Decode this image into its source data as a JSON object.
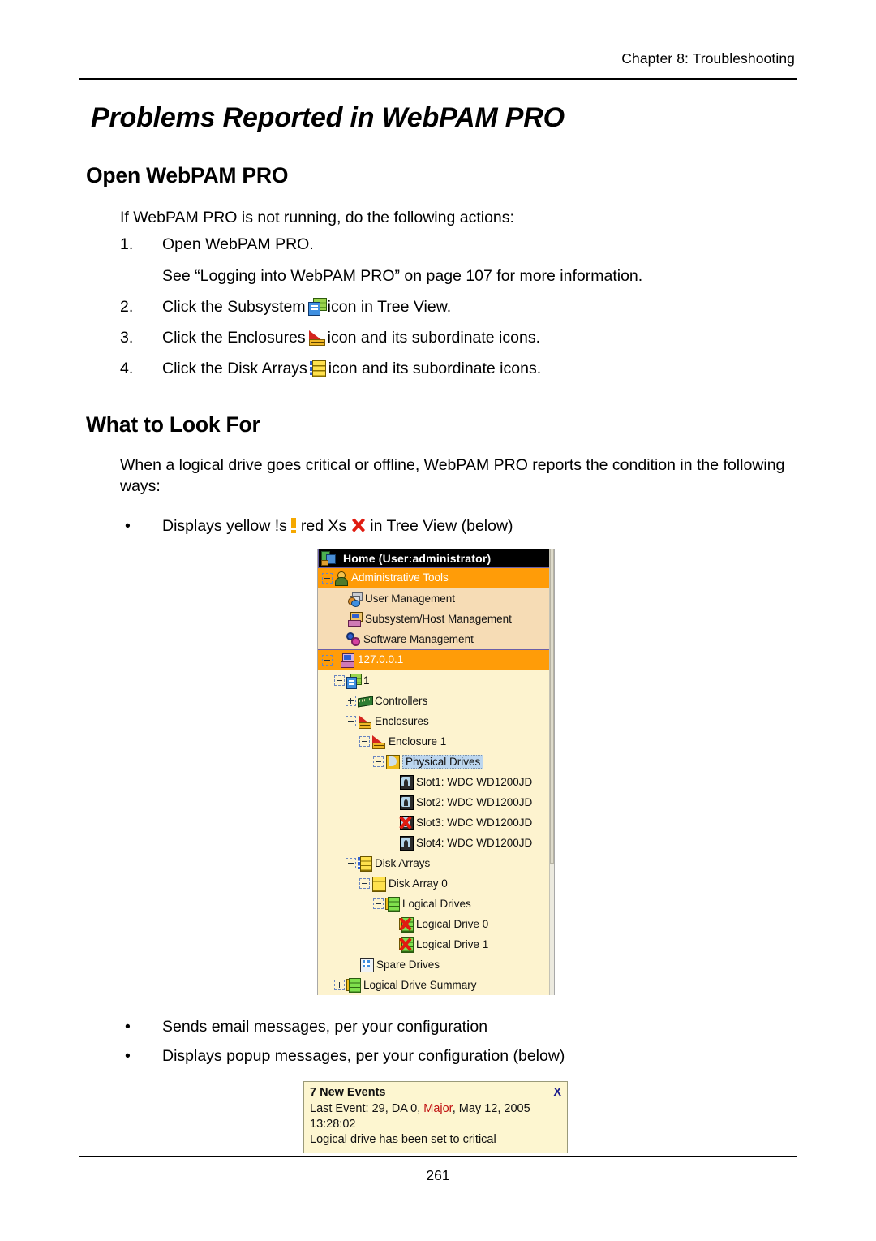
{
  "page": {
    "running_head": "Chapter 8: Troubleshooting",
    "page_number": "261",
    "title": "Problems Reported in WebPAM PRO"
  },
  "sections": {
    "open": {
      "heading": "Open WebPAM PRO",
      "intro": "If WebPAM PRO is not running, do the following actions:",
      "steps": [
        {
          "num": "1.",
          "text": "Open WebPAM PRO.",
          "note": "See “Logging into WebPAM PRO” on page 107 for more information.",
          "icon": ""
        },
        {
          "num": "2.",
          "text_before": "Click the Subsystem",
          "icon": "subsystem-icon",
          "text_after": "icon in Tree View."
        },
        {
          "num": "3.",
          "text_before": "Click the Enclosures",
          "icon": "enclosure-icon",
          "text_after": "icon and its subordinate icons."
        },
        {
          "num": "4.",
          "text_before": "Click the Disk Arrays",
          "icon": "disk-array-icon",
          "text_after": "icon and its subordinate icons."
        }
      ]
    },
    "look": {
      "heading": "What to Look For",
      "intro": "When a logical drive goes critical or offline, WebPAM PRO reports the condition in the following ways:",
      "bullet_dot": "•",
      "bullets_top": [
        {
          "text_before": "Displays yellow !s",
          "icon1": "yellow-exclamation-icon",
          "text_mid": "red Xs",
          "icon2": "red-x-icon",
          "text_after": "in Tree View (below)"
        }
      ],
      "bullets_bottom": [
        "Sends email messages, per your configuration",
        "Displays popup messages, per your configuration (below)"
      ]
    }
  },
  "tree": {
    "header": {
      "label": "Home (User:administrator)",
      "icon": "home-icon"
    },
    "rows": [
      {
        "label": "Administrative Tools",
        "icon": "person-icon",
        "indent": 0,
        "exp": "minus",
        "style": "orange"
      },
      {
        "label": "User Management",
        "icon": "user-mgmt-icon",
        "indent": 1,
        "exp": "none",
        "style": "peach"
      },
      {
        "label": "Subsystem/Host Management",
        "icon": "host-mgmt-icon",
        "indent": 1,
        "exp": "none",
        "style": "peach"
      },
      {
        "label": "Software Management",
        "icon": "gears-icon",
        "indent": 1,
        "exp": "none",
        "style": "peach"
      },
      {
        "label": "127.0.0.1",
        "icon": "ip-host-icon",
        "indent": 0,
        "exp": "minus",
        "style": "orange"
      },
      {
        "label": "1",
        "icon": "subsystem-icon",
        "indent": 1,
        "exp": "minus",
        "style": "plain"
      },
      {
        "label": "Controllers",
        "icon": "controller-icon",
        "indent": 2,
        "exp": "plus",
        "style": "plain"
      },
      {
        "label": "Enclosures",
        "icon": "enclosure-icon",
        "indent": 2,
        "exp": "minus",
        "style": "plain"
      },
      {
        "label": "Enclosure 1",
        "icon": "enclosure-icon",
        "indent": 3,
        "exp": "minus",
        "style": "plain"
      },
      {
        "label": "Physical Drives",
        "icon": "pd-folder-icon",
        "indent": 4,
        "exp": "minus",
        "style": "selected"
      },
      {
        "label": "Slot1: WDC WD1200JD",
        "icon": "physical-drive-icon",
        "indent": 5,
        "exp": "none",
        "style": "plain"
      },
      {
        "label": "Slot2: WDC WD1200JD",
        "icon": "physical-drive-icon",
        "indent": 5,
        "exp": "none",
        "style": "plain"
      },
      {
        "label": "Slot3: WDC WD1200JD",
        "icon": "physical-drive-icon",
        "indent": 5,
        "exp": "none",
        "style": "plain",
        "error": true
      },
      {
        "label": "Slot4: WDC WD1200JD",
        "icon": "physical-drive-icon",
        "indent": 5,
        "exp": "none",
        "style": "plain"
      },
      {
        "label": "Disk Arrays",
        "icon": "disk-array-icon",
        "indent": 2,
        "exp": "minus",
        "style": "plain"
      },
      {
        "label": "Disk Array 0",
        "icon": "disk-array-plain-icon",
        "indent": 3,
        "exp": "minus",
        "style": "plain"
      },
      {
        "label": "Logical Drives",
        "icon": "logical-drive-icon",
        "indent": 4,
        "exp": "minus",
        "style": "plain"
      },
      {
        "label": "Logical Drive 0",
        "icon": "logical-drive-icon",
        "indent": 5,
        "exp": "none",
        "style": "plain",
        "error": true
      },
      {
        "label": "Logical Drive 1",
        "icon": "logical-drive-icon",
        "indent": 5,
        "exp": "none",
        "style": "plain",
        "error": true
      },
      {
        "label": "Spare Drives",
        "icon": "spare-drive-icon",
        "indent": 2,
        "exp": "none",
        "style": "plain"
      },
      {
        "label": "Logical Drive Summary",
        "icon": "logical-drive-icon",
        "indent": 2,
        "exp": "plus",
        "style": "plain"
      }
    ]
  },
  "popup": {
    "title": "7 New Events",
    "close_label": "X",
    "line1_prefix": "Last Event: 29, DA 0, ",
    "severity": "Major",
    "line1_suffix": ", May 12, 2005 13:28:02",
    "line2": "Logical drive has been set to critical"
  },
  "colors": {
    "tree_background": "#fdf3cf",
    "tree_selected_row": "#ff9c08",
    "tree_child_background": "#f6dcb5",
    "tree_text_selection": "#bcd6ef",
    "popup_background": "#fdf6d0",
    "severity_major": "#c01010",
    "error_x": "#e01b10",
    "warning": "#f5a800"
  }
}
